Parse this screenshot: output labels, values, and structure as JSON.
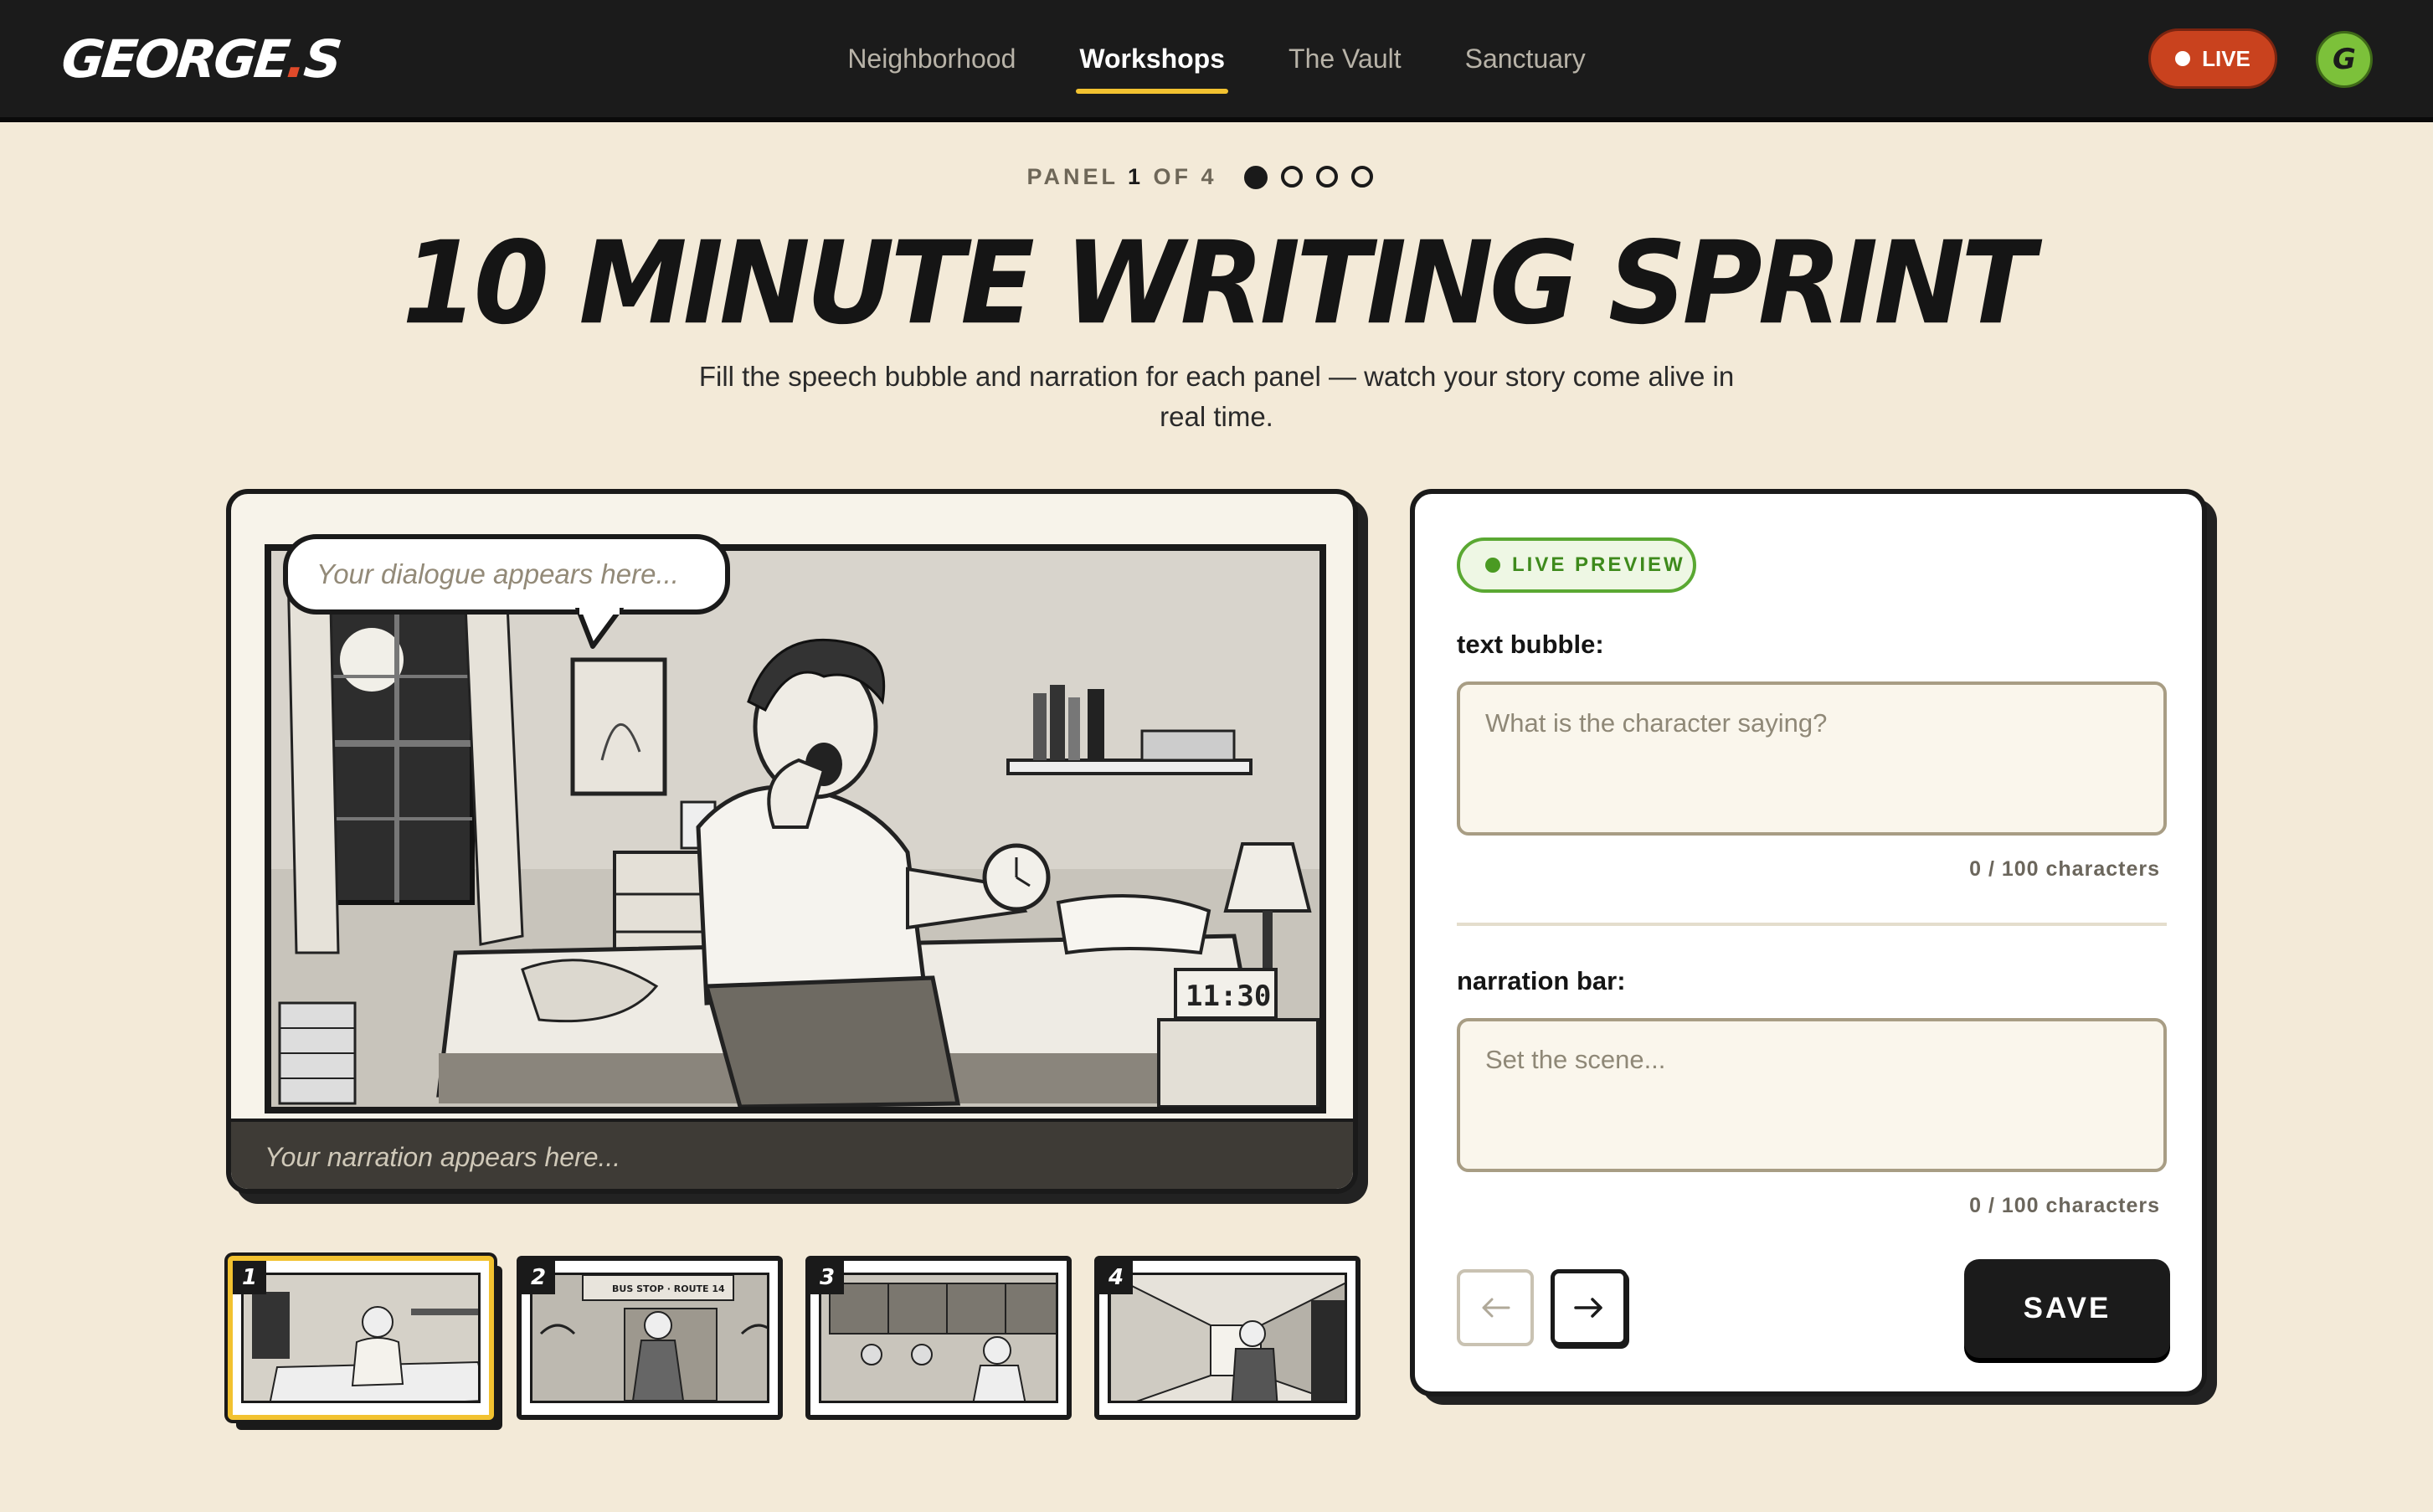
{
  "app": {
    "logo": "GEORGE",
    "logo_dot": ".",
    "logo_tail": "S"
  },
  "nav": {
    "items": [
      {
        "label": "Neighborhood",
        "active": false
      },
      {
        "label": "Workshops",
        "active": true
      },
      {
        "label": "The Vault",
        "active": false
      },
      {
        "label": "Sanctuary",
        "active": false
      }
    ]
  },
  "header": {
    "live_label": "LIVE",
    "avatar_initial": "G",
    "panel_word": "PANEL",
    "panel_current": "1",
    "panel_of": "OF 4",
    "title": "10 MINUTE WRITING SPRINT",
    "subtitle": "Fill the speech bubble and narration for each panel — watch your story come alive in real time."
  },
  "comic": {
    "bubble_placeholder": "Your dialogue appears here...",
    "narration_placeholder": "Your narration appears here...",
    "clock_text": "11:30"
  },
  "thumbnails": [
    {
      "num": "1",
      "active": true
    },
    {
      "num": "2",
      "active": false,
      "sign": "BUS STOP · ROUTE 14"
    },
    {
      "num": "3",
      "active": false
    },
    {
      "num": "4",
      "active": false
    }
  ],
  "preview": {
    "badge": "LIVE PREVIEW",
    "bubble_label": "text bubble:",
    "bubble_placeholder": "What is the character saying?",
    "bubble_counter": "0 / 100 characters",
    "narration_label": "narration bar:",
    "narration_placeholder": "Set the scene...",
    "narration_counter": "0 / 100 characters",
    "save_label": "SAVE"
  },
  "colors": {
    "background": "#f3ead8",
    "topbar": "#1b1b1b",
    "accent_yellow": "#f2c230",
    "live_red": "#c9421e",
    "avatar_green": "#7cc13a",
    "preview_green": "#5aa832"
  },
  "icons": {
    "prev": "arrow-left-icon",
    "next": "arrow-right-icon"
  }
}
